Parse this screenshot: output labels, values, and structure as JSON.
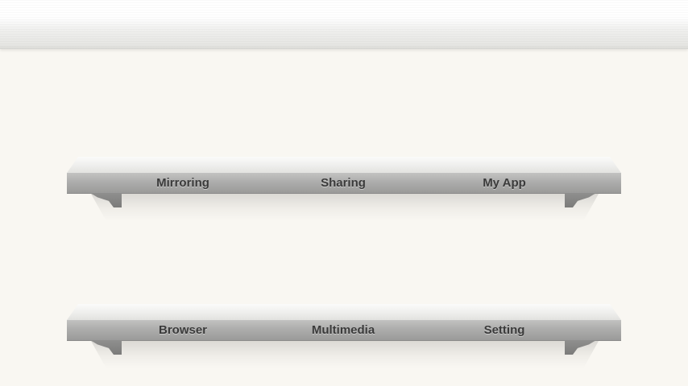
{
  "shelves": [
    {
      "items": [
        {
          "label": "Mirroring"
        },
        {
          "label": "Sharing"
        },
        {
          "label": "My App"
        }
      ]
    },
    {
      "items": [
        {
          "label": "Browser"
        },
        {
          "label": "Multimedia"
        },
        {
          "label": "Setting"
        }
      ]
    }
  ],
  "colors": {
    "background": "#f9f7f2",
    "shelf_front": "#adadac",
    "label_text": "#3a3a3a"
  }
}
